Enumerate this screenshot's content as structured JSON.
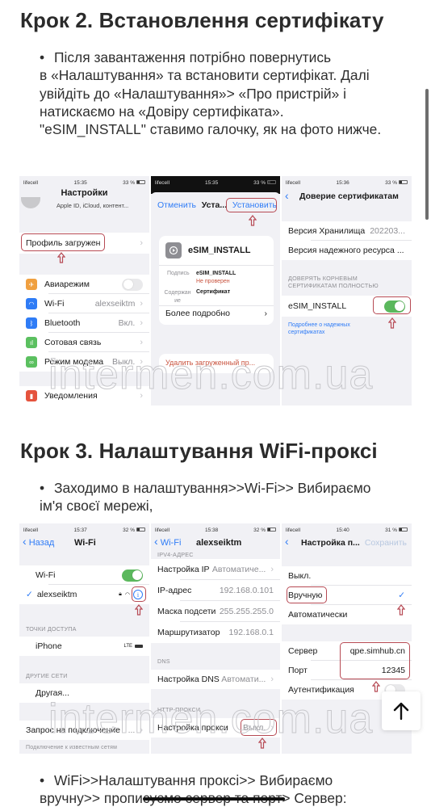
{
  "step2": {
    "title": "Крок 2. Встановлення сертифікату",
    "paragraph": [
      "Після завантаження потрібно повернутись",
      "в «Налаштування» та встановити сертифікат. Далі",
      "увійдіть до «Налаштування»> «Про пристрій» і",
      "натискаємо на «Довіру сертифіката».",
      "\"eSIM_INSTALL\" ставимо галочку, як на фото нижче."
    ],
    "screens": {
      "settings": {
        "status": {
          "carrier": "lifecell",
          "time": "15:35",
          "battery": "33 %"
        },
        "title": "Настройки",
        "apple_id": "Apple ID, iCloud, контент...",
        "profile": "Профиль загружен",
        "items": [
          {
            "label": "Авиарежим",
            "value": "",
            "icon": "airplane-icon",
            "color": "#f0a040"
          },
          {
            "label": "Wi-Fi",
            "value": "alexseiktm",
            "icon": "wifi-icon",
            "color": "#2f7cf6"
          },
          {
            "label": "Bluetooth",
            "value": "Вкл.",
            "icon": "bluetooth-icon",
            "color": "#2f7cf6"
          },
          {
            "label": "Сотовая связь",
            "value": "",
            "icon": "cellular-icon",
            "color": "#5bc060"
          },
          {
            "label": "Режим модема",
            "value": "Выкл.",
            "icon": "hotspot-icon",
            "color": "#5bc060"
          },
          {
            "label": "Уведомления",
            "value": "",
            "icon": "notifications-icon",
            "color": "#e5533d"
          }
        ]
      },
      "install": {
        "status": {
          "carrier": "lifecell",
          "time": "15:35",
          "battery": "33 %"
        },
        "cancel": "Отменить",
        "title": "Уста...",
        "install": "Установить",
        "profile_name": "eSIM_INSTALL",
        "signed_label": "Подпись",
        "signed_value": "eSIM_INSTALL",
        "not_verified": "Не проверен",
        "contains_label": "Содержан ие",
        "contains_value": "Сертификат",
        "more": "Более подробно",
        "remove": "Удалить загруженный пр..."
      },
      "trust": {
        "status": {
          "carrier": "lifecell",
          "time": "15:36",
          "battery": "33 %"
        },
        "title": "Доверие сертификатам",
        "store_label": "Версия Хранилища",
        "store_value": "202203...",
        "asset_label": "Версия надежного ресурса ...",
        "section": "ДОВЕРЯТЬ КОРНЕВЫМ СЕРТИФИКАТАМ ПОЛНОСТЬЮ",
        "cert": "eSIM_INSTALL",
        "cert_trusted": true,
        "learn_more": "Подробнее о надежных сертификатах"
      }
    }
  },
  "step3": {
    "title": "Крок 3. Налаштування WiFi-проксі",
    "paragraph": [
      "Заходимо в налаштування>>Wi-Fi>> Вибираємо",
      "ім'я своєї мережі,"
    ],
    "screens": {
      "wifi": {
        "status": {
          "carrier": "lifecell",
          "time": "15:37",
          "battery": "32 %"
        },
        "back": "Назад",
        "title": "Wi-Fi",
        "wifi_label": "Wi-Fi",
        "wifi_on": true,
        "network": "alexseiktm",
        "hotspots_section": "ТОЧКИ ДОСТУПА",
        "hotspot": "iPhone",
        "hotspot_signal": "LTE",
        "other_section": "ДРУГИЕ СЕТИ",
        "other": "Другая...",
        "ask_join": "Запрос на подключение",
        "ask_join_value": "...",
        "known": "Подключение к известным сетям"
      },
      "network": {
        "status": {
          "carrier": "lifecell",
          "time": "15:38",
          "battery": "32 %"
        },
        "back": "Wi-Fi",
        "title": "alexseiktm",
        "ipv4_section": "IPV4-АДРЕС",
        "rows": [
          {
            "label": "Настройка IP",
            "value": "Автоматиче..."
          },
          {
            "label": "IP-адрес",
            "value": "192.168.0.101"
          },
          {
            "label": "Маска подсети",
            "value": "255.255.255.0"
          },
          {
            "label": "Маршрутизатор",
            "value": "192.168.0.1"
          }
        ],
        "dns_section": "DNS",
        "dns_label": "Настройка DNS",
        "dns_value": "Автомати...",
        "proxy_section": "HTTP-ПРОКСИ",
        "proxy_label": "Настройка прокси",
        "proxy_value": "Выкл."
      },
      "proxy": {
        "status": {
          "carrier": "lifecell",
          "time": "15:40",
          "battery": "31 %"
        },
        "title": "Настройка п...",
        "save": "Сохранить",
        "options": [
          "Выкл.",
          "Вручную",
          "Автоматически"
        ],
        "selected": "Вручную",
        "server_label": "Сервер",
        "server_value": "qpe.simhub.cn",
        "port_label": "Порт",
        "port_value": "12345",
        "auth_label": "Аутентификация"
      }
    },
    "paragraph2": {
      "line1": "WiFi>>Налаштування проксі>> Вибираємо",
      "line2_start": "вручну>> пропи",
      "line2_struck": "суємо сервер та порт",
      "line2_end": "> Сервер:"
    }
  },
  "watermark": "intermen.com.ua",
  "scroll_top_icon": "arrow-up-icon"
}
